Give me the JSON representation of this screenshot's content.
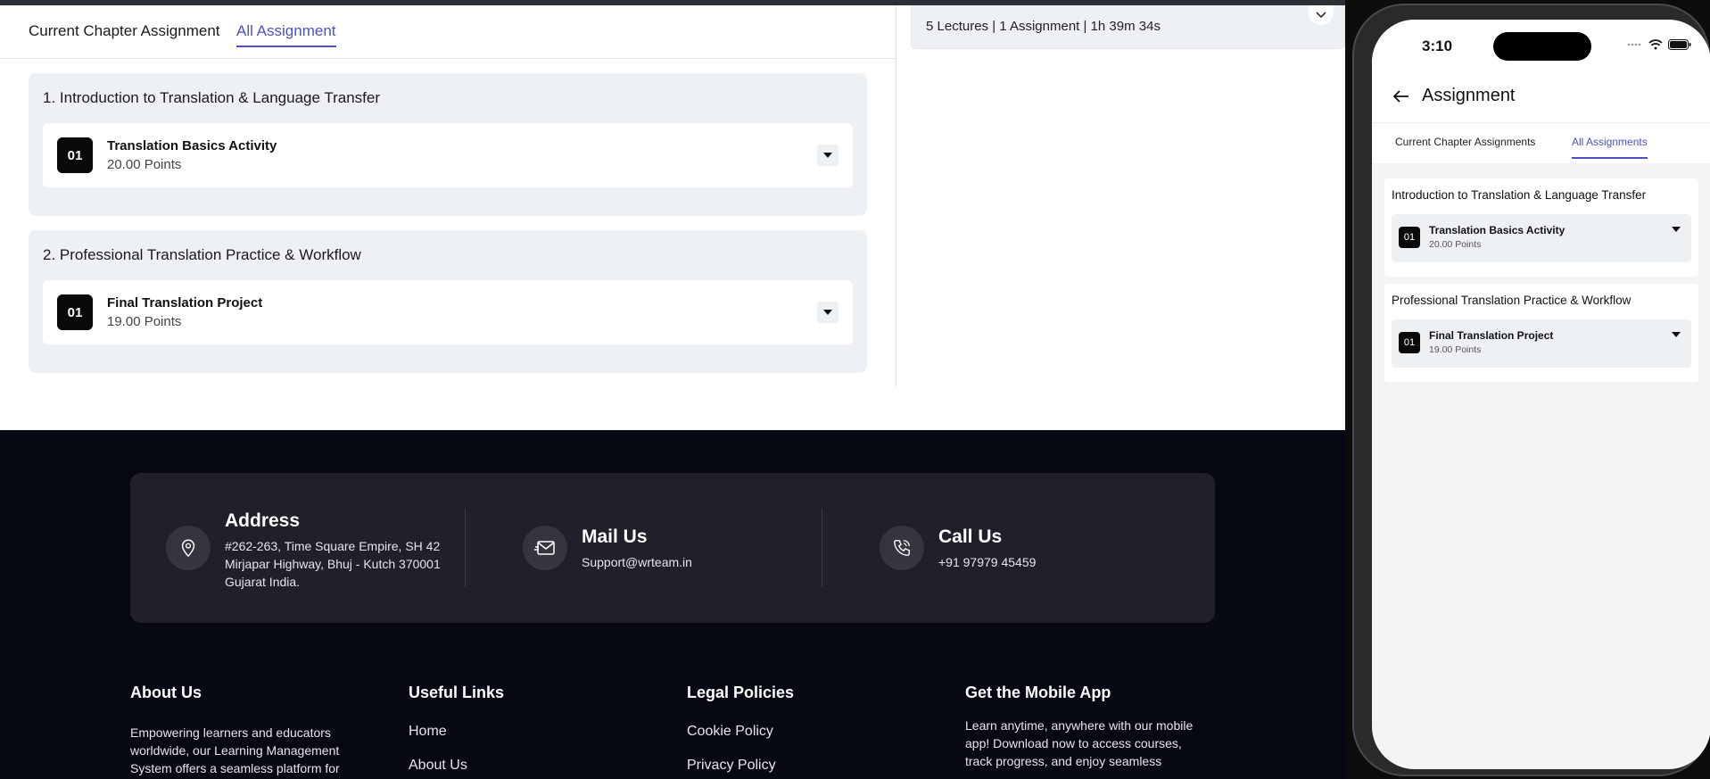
{
  "web": {
    "tabs": [
      {
        "label": "Current Chapter Assignment"
      },
      {
        "label": "All Assignment"
      }
    ],
    "course_summary": "5 Lectures | 1 Assignment | 1h 39m 34s",
    "chapters": [
      {
        "title": "1. Introduction to Translation & Language Transfer",
        "assignment": {
          "number": "01",
          "name": "Translation Basics Activity",
          "points": "20.00 Points"
        }
      },
      {
        "title": "2. Professional Translation Practice & Workflow",
        "assignment": {
          "number": "01",
          "name": "Final Translation Project",
          "points": "19.00 Points"
        }
      }
    ],
    "footer": {
      "address": {
        "title": "Address",
        "value": "#262-263, Time Square Empire, SH 42 Mirjapar Highway, Bhuj - Kutch 370001 Gujarat India."
      },
      "mail": {
        "title": "Mail Us",
        "value": "Support@wrteam.in"
      },
      "call": {
        "title": "Call Us",
        "value": "+91 97979 45459"
      },
      "about": {
        "heading": "About Us",
        "text": "Empowering learners and educators worldwide, our Learning Management System offers a seamless platform for"
      },
      "useful_links": {
        "heading": "Useful Links",
        "links": [
          "Home",
          "About Us"
        ]
      },
      "legal": {
        "heading": "Legal Policies",
        "links": [
          "Cookie Policy",
          "Privacy Policy"
        ]
      },
      "mobile_app": {
        "heading": "Get the Mobile App",
        "text": "Learn anytime, anywhere with our mobile app! Download now to access courses, track progress, and enjoy seamless"
      }
    }
  },
  "phone": {
    "time": "3:10",
    "title": "Assignment",
    "tabs": [
      {
        "label": "Current Chapter Assignments"
      },
      {
        "label": "All Assignments"
      }
    ],
    "chapters": [
      {
        "title": "Introduction to Translation & Language Transfer",
        "assignment": {
          "number": "01",
          "name": "Translation Basics Activity",
          "points": "20.00 Points"
        }
      },
      {
        "title": "Professional Translation Practice & Workflow",
        "assignment": {
          "number": "01",
          "name": "Final Translation Project",
          "points": "19.00 Points"
        }
      }
    ]
  },
  "colors": {
    "accent": "#4b52c6",
    "footer_bg": "#060814",
    "contact_bg": "#1f2029",
    "card_bg": "#eef1f4"
  },
  "icons": [
    "location-pin-icon",
    "mail-icon",
    "phone-icon",
    "chevron-down-icon",
    "caret-down-icon",
    "back-arrow-icon",
    "wifi-icon",
    "battery-icon",
    "signal-icon"
  ]
}
